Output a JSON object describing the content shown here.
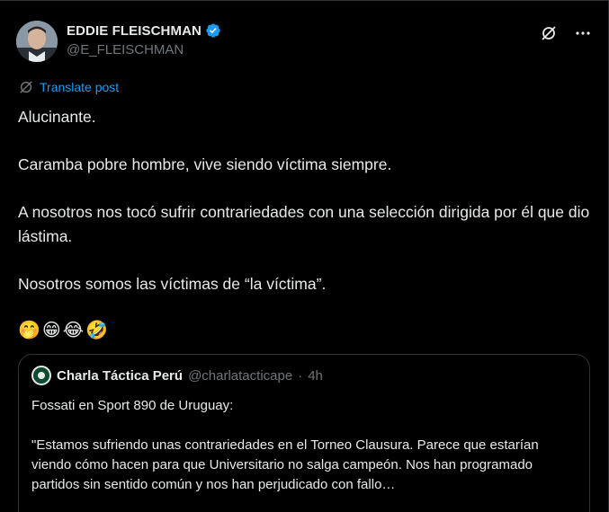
{
  "author": {
    "display_name": "EDDIE FLEISCHMAN",
    "handle": "@E_FLEISCHMAN",
    "verified": true
  },
  "icons": {
    "verified": "verified-badge-icon",
    "grok": "grok-icon",
    "more": "more-icon",
    "translate": "translate-icon"
  },
  "translate_label": "Translate post",
  "tweet": {
    "lines": [
      "Alucinante.",
      "Caramba pobre hombre, vive siendo víctima siempre.",
      "A nosotros nos tocó sufrir contrariedades con una selección dirigida por él que dio lástima.",
      "Nosotros somos las víctimas de “la víctima”."
    ],
    "emojis": [
      "🤭",
      "😁",
      "😂",
      "🤣"
    ]
  },
  "quote": {
    "name": "Charla Táctica Perú",
    "handle": "@charlatacticape",
    "separator": "·",
    "time": "4h",
    "lines": [
      "Fossati en Sport 890 de Uruguay:",
      "\"Estamos sufriendo unas contrariedades en el Torneo Clausura. Parece que estarían viendo cómo hacen para que Universitario no salga campeón. Nos han programado partidos sin sentido común y nos han perjudicado con fallo…"
    ]
  },
  "colors": {
    "background": "#000000",
    "text": "#e7e9ea",
    "muted": "#71767b",
    "accent": "#1d9bf0",
    "border": "#2f3336"
  }
}
